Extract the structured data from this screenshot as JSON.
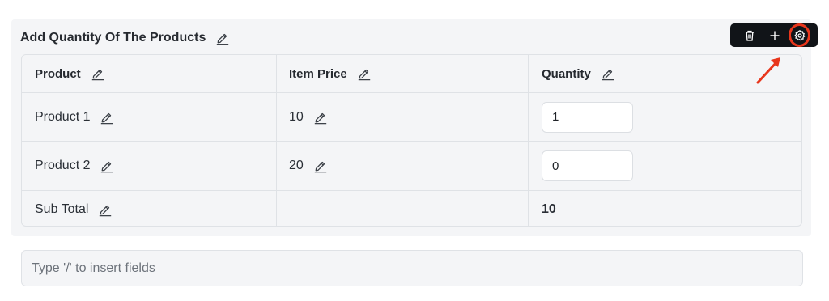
{
  "block": {
    "title": "Add Quantity Of The Products",
    "toolbar": {
      "delete_icon": "trash-icon",
      "add_icon": "plus-icon",
      "settings_icon": "gear-icon",
      "highlight_color": "#e8361c"
    }
  },
  "table": {
    "headers": [
      "Product",
      "Item Price",
      "Quantity"
    ],
    "rows": [
      {
        "product": "Product 1",
        "price": "10",
        "quantity": "1"
      },
      {
        "product": "Product 2",
        "price": "20",
        "quantity": "0"
      }
    ],
    "subtotal": {
      "label": "Sub Total",
      "value": "10"
    }
  },
  "insert": {
    "placeholder": "Type '/' to insert fields"
  },
  "colors": {
    "accent": "#e8361c",
    "toolbar_bg": "#111418",
    "panel_bg": "#f4f5f7"
  }
}
